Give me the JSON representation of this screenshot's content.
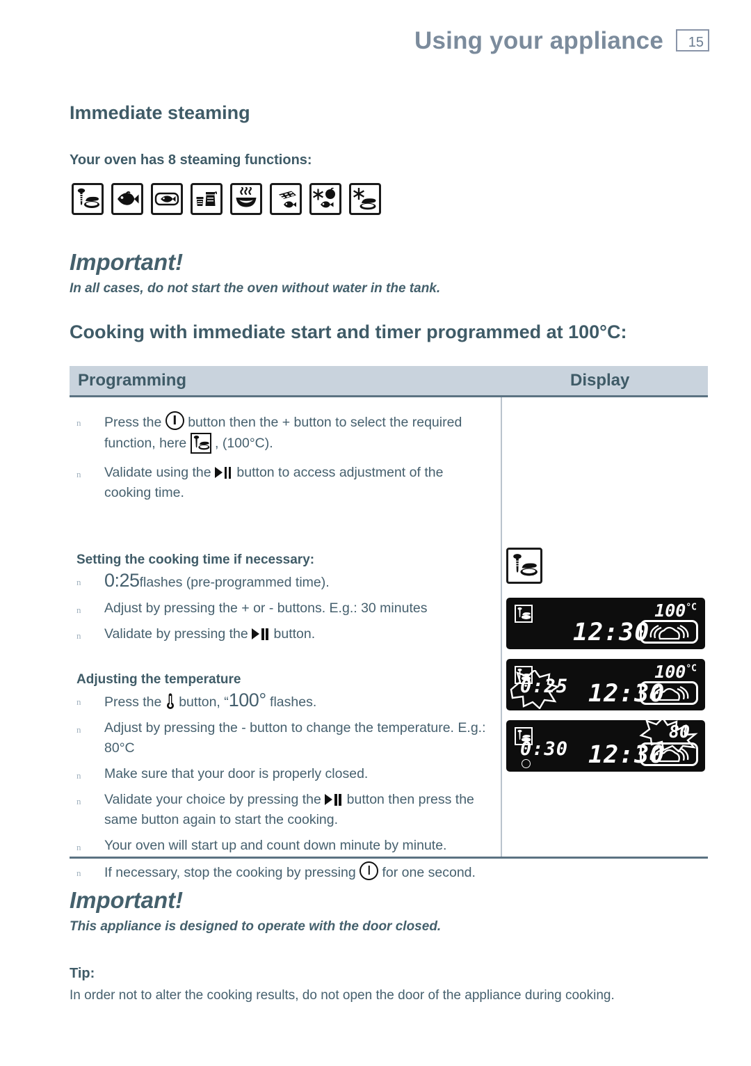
{
  "header": {
    "title": "Using your appliance",
    "page_number": "15"
  },
  "section": {
    "heading": "Immediate steaming",
    "subheading": "Your oven has 8 steaming functions:",
    "function_icons": [
      "vegetables-and-meat-icon",
      "fish-icon",
      "fish-in-dish-icon",
      "jars-preserving-icon",
      "bowl-steam-icon",
      "chocolate-and-fish-icon",
      "defrost-vegetables-fish-icon",
      "defrost-meat-icon"
    ]
  },
  "important_top": {
    "title": "Important!",
    "text": "In all cases, do not start the oven without water in the tank."
  },
  "procedure_heading": "Cooking with immediate start and timer programmed at 100°C:",
  "table": {
    "columns": [
      "Programming",
      "Display"
    ],
    "programming": {
      "intro_bullets": [
        {
          "parts": [
            {
              "t": "text",
              "v": "Press the "
            },
            {
              "t": "icon",
              "v": "power-button-icon"
            },
            {
              "t": "text",
              "v": " button then the +  button to select the required function, here "
            },
            {
              "t": "icon",
              "v": "vegetables-and-meat-icon"
            },
            {
              "t": "text",
              "v": " , (100°C)."
            }
          ]
        },
        {
          "parts": [
            {
              "t": "text",
              "v": "Validate using the "
            },
            {
              "t": "icon",
              "v": "play-pause-icon"
            },
            {
              "t": "text",
              "v": " button to access adjustment of the cooking time."
            }
          ]
        }
      ],
      "cooking_time": {
        "heading": "Setting the cooking time if necessary:",
        "bullets": [
          {
            "parts": [
              {
                "t": "big",
                "v": "0:25"
              },
              {
                "t": "text",
                "v": "flashes (pre-programmed time)."
              }
            ]
          },
          {
            "parts": [
              {
                "t": "text",
                "v": "Adjust by pressing the + or - buttons. E.g.: 30 minutes"
              }
            ]
          },
          {
            "parts": [
              {
                "t": "text",
                "v": "Validate by pressing the "
              },
              {
                "t": "icon",
                "v": "play-pause-icon"
              },
              {
                "t": "text",
                "v": " button."
              }
            ]
          }
        ]
      },
      "temperature": {
        "heading": "Adjusting the temperature",
        "bullets": [
          {
            "parts": [
              {
                "t": "text",
                "v": "Press the "
              },
              {
                "t": "icon",
                "v": "thermometer-icon"
              },
              {
                "t": "text",
                "v": " button, “"
              },
              {
                "t": "big",
                "v": "100°"
              },
              {
                "t": "text",
                "v": " flashes."
              }
            ]
          },
          {
            "parts": [
              {
                "t": "text",
                "v": "Adjust by pressing the - button to change the temperature. E.g.: 80°C"
              }
            ]
          },
          {
            "parts": [
              {
                "t": "text",
                "v": "Make sure that your door is properly closed."
              }
            ]
          },
          {
            "parts": [
              {
                "t": "text",
                "v": "Validate your choice by pressing the "
              },
              {
                "t": "icon",
                "v": "play-pause-icon"
              },
              {
                "t": "text",
                "v": " button then press the same button again to start the cooking."
              }
            ]
          },
          {
            "parts": [
              {
                "t": "text",
                "v": "Your oven will start up and count down minute by minute."
              }
            ]
          },
          {
            "parts": [
              {
                "t": "text",
                "v": "If necessary, stop the cooking by pressing "
              },
              {
                "t": "icon",
                "v": "power-button-icon"
              },
              {
                "t": "text",
                "v": " for one second."
              }
            ]
          }
        ]
      }
    },
    "display": {
      "function_icon": "vegetables-and-meat-icon",
      "panels": [
        {
          "name": "lcd-panel-clock",
          "badge": "vegetables-and-meat-icon",
          "clock": "12:30",
          "timer": "",
          "timer_flashing": false,
          "temperature": "100",
          "temperature_unit": "°C",
          "temperature_flashing": false,
          "steam_indicator": true
        },
        {
          "name": "lcd-panel-cooking-time-flashing",
          "badge": "vegetables-and-meat-icon",
          "clock": "12:30",
          "timer": "0:25",
          "timer_flashing": true,
          "temperature": "100",
          "temperature_unit": "°C",
          "temperature_flashing": false,
          "steam_indicator": true
        },
        {
          "name": "lcd-panel-temperature-flashing",
          "badge": "vegetables-and-meat-icon",
          "clock": "12:30",
          "timer": "0:30",
          "timer_flashing": false,
          "temperature": "80",
          "temperature_unit": "",
          "temperature_flashing": true,
          "steam_indicator": true
        }
      ]
    }
  },
  "important_bottom": {
    "title": "Important!",
    "text": "This appliance is designed to operate with the door closed."
  },
  "tip": {
    "label": "Tip:",
    "text": "In order not to alter the cooking results, do not open the door of the appliance during cooking."
  },
  "colors": {
    "heading": "#3f5b67",
    "body": "#46606e",
    "header_title": "#7b8b9c",
    "table_header_bg": "#c9d3dd",
    "rule": "#5b7282",
    "lcd_bg": "#0d0d0d"
  }
}
